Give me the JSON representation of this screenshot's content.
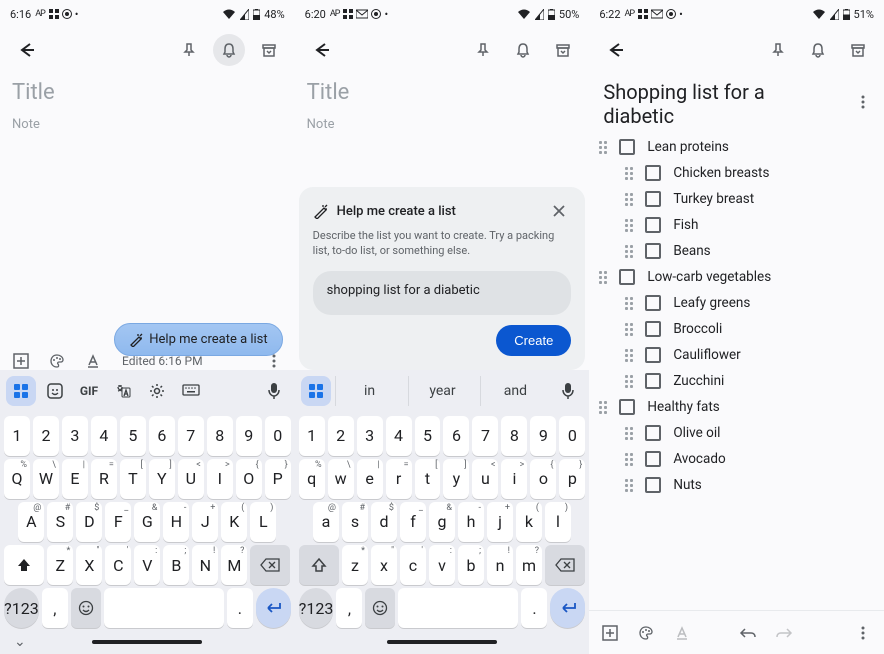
{
  "pane1": {
    "status": {
      "time": "6:16",
      "battery": "48%"
    },
    "title_placeholder": "Title",
    "note_placeholder": "Note",
    "chip_label": "Help me create a list",
    "edited_label": "Edited 6:16 PM"
  },
  "pane2": {
    "status": {
      "time": "6:20",
      "battery": "50%"
    },
    "title_placeholder": "Title",
    "note_placeholder": "Note",
    "help": {
      "title": "Help me create a list",
      "description": "Describe the list you want to create. Try a packing list, to-do list, or something else.",
      "input_value": "shopping list for a diabetic",
      "create_label": "Create"
    },
    "suggestions": [
      "in",
      "year",
      "and"
    ]
  },
  "pane3": {
    "status": {
      "time": "6:22",
      "battery": "51%"
    },
    "title": "Shopping list for a diabetic",
    "items": [
      {
        "label": "Lean proteins",
        "indent": 0
      },
      {
        "label": "Chicken breasts",
        "indent": 1
      },
      {
        "label": "Turkey breast",
        "indent": 1
      },
      {
        "label": "Fish",
        "indent": 1
      },
      {
        "label": "Beans",
        "indent": 1
      },
      {
        "label": "Low-carb vegetables",
        "indent": 0
      },
      {
        "label": "Leafy greens",
        "indent": 1
      },
      {
        "label": "Broccoli",
        "indent": 1
      },
      {
        "label": "Cauliflower",
        "indent": 1
      },
      {
        "label": "Zucchini",
        "indent": 1
      },
      {
        "label": "Healthy fats",
        "indent": 0
      },
      {
        "label": "Olive oil",
        "indent": 1
      },
      {
        "label": "Avocado",
        "indent": 1
      },
      {
        "label": "Nuts",
        "indent": 1
      }
    ]
  },
  "keyboard": {
    "row_num": [
      "1",
      "2",
      "3",
      "4",
      "5",
      "6",
      "7",
      "8",
      "9",
      "0"
    ],
    "row1_lower": [
      "q",
      "w",
      "e",
      "r",
      "t",
      "y",
      "u",
      "i",
      "o",
      "p"
    ],
    "row1_upper": [
      "Q",
      "W",
      "E",
      "R",
      "T",
      "Y",
      "U",
      "I",
      "O",
      "P"
    ],
    "row1_sup": [
      "%",
      "\\",
      "|",
      "=",
      "[",
      "]",
      "<",
      ">",
      "{",
      "}"
    ],
    "row2_lower": [
      "a",
      "s",
      "d",
      "f",
      "g",
      "h",
      "j",
      "k",
      "l"
    ],
    "row2_upper": [
      "A",
      "S",
      "D",
      "F",
      "G",
      "H",
      "J",
      "K",
      "L"
    ],
    "row2_sup": [
      "@",
      "#",
      "$",
      "_",
      "&",
      "-",
      "+",
      "(",
      ")"
    ],
    "row3_lower": [
      "z",
      "x",
      "c",
      "v",
      "b",
      "n",
      "m"
    ],
    "row3_upper": [
      "Z",
      "X",
      "C",
      "V",
      "B",
      "N",
      "M"
    ],
    "row3_sup": [
      "*",
      "\"",
      "'",
      ":",
      ";",
      "!",
      "?"
    ],
    "symkey": "?123",
    "comma": ",",
    "period": "."
  }
}
